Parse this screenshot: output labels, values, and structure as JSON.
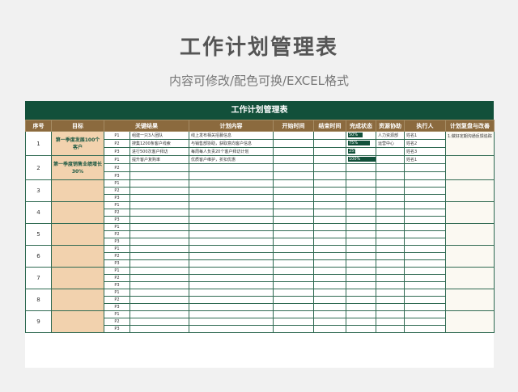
{
  "header": {
    "title": "工作计划管理表",
    "subtitle": "内容可修改/配色可换/EXCEL格式"
  },
  "sheet": {
    "title": "工作计划管理表",
    "columns": [
      "序号",
      "目标",
      "关键结果",
      "计划内容",
      "开始时间",
      "结束时间",
      "完成状态",
      "资源协助",
      "执行人",
      "计划复盘与改善"
    ],
    "groups": [
      {
        "seq": "1",
        "goal": "第一季度发展100个客户",
        "review": "1.做好定期沟通反馈追踪",
        "rows": [
          {
            "p": "P1",
            "kr": "组建一只3人团队",
            "plan": "线上发布相关招募信息",
            "status": "50%",
            "progress": 0.5,
            "resource": "人力资源部",
            "owner": "姓名1"
          },
          {
            "p": "P2",
            "kr": "搜集1200条客户线索",
            "plan": "与销售部协助，获取意向客户信息",
            "status": "75%",
            "progress": 0.75,
            "resource": "运营中心",
            "owner": "姓名2"
          },
          {
            "p": "P3",
            "kr": "进行500次客户拜访",
            "plan": "每周每人负责20个客户拜访计划",
            "status": "25%",
            "progress": 0.25,
            "resource": "",
            "owner": "姓名3"
          }
        ]
      },
      {
        "seq": "2",
        "goal": "第一季度销售业绩增长30%",
        "review": "",
        "rows": [
          {
            "p": "P1",
            "kr": "提升客户复购率",
            "plan": "优质客户维护，折扣优惠",
            "status": "100%",
            "progress": 1.0,
            "resource": "",
            "owner": "姓名1"
          },
          {
            "p": "P2",
            "kr": "",
            "plan": "",
            "status": "",
            "progress": 0,
            "resource": "",
            "owner": ""
          },
          {
            "p": "P3",
            "kr": "",
            "plan": "",
            "status": "",
            "progress": 0,
            "resource": "",
            "owner": ""
          }
        ]
      },
      {
        "seq": "3",
        "goal": "",
        "review": "",
        "rows": [
          {
            "p": "P1"
          },
          {
            "p": "P2"
          },
          {
            "p": "P3"
          }
        ]
      },
      {
        "seq": "4",
        "goal": "",
        "review": "",
        "rows": [
          {
            "p": "P1"
          },
          {
            "p": "P2"
          },
          {
            "p": "P3"
          }
        ]
      },
      {
        "seq": "5",
        "goal": "",
        "review": "",
        "rows": [
          {
            "p": "P1"
          },
          {
            "p": "P2"
          },
          {
            "p": "P3"
          }
        ]
      },
      {
        "seq": "6",
        "goal": "",
        "review": "",
        "rows": [
          {
            "p": "P1"
          },
          {
            "p": "P2"
          },
          {
            "p": "P3"
          }
        ]
      },
      {
        "seq": "7",
        "goal": "",
        "review": "",
        "rows": [
          {
            "p": "P1"
          },
          {
            "p": "P2"
          },
          {
            "p": "P3"
          }
        ]
      },
      {
        "seq": "8",
        "goal": "",
        "review": "",
        "rows": [
          {
            "p": "P1"
          },
          {
            "p": "P2"
          },
          {
            "p": "P3"
          }
        ]
      },
      {
        "seq": "9",
        "goal": "",
        "review": "",
        "rows": [
          {
            "p": "P1"
          },
          {
            "p": "P2"
          },
          {
            "p": "P3"
          }
        ]
      }
    ]
  },
  "colors": {
    "header_green": "#12503a",
    "column_brown": "#8b6a3e",
    "goal_fill": "#f2d2ae"
  }
}
